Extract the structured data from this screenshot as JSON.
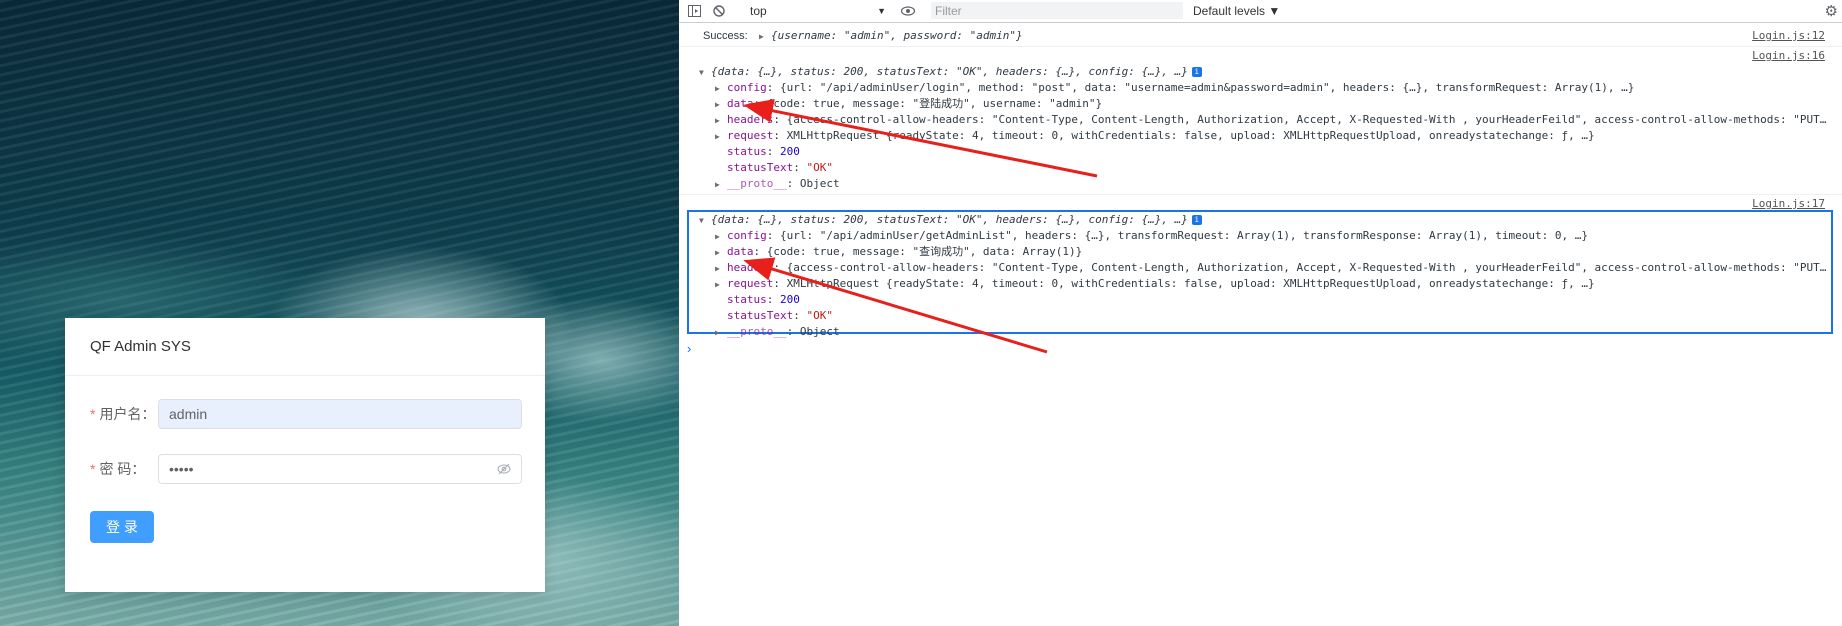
{
  "login": {
    "title": "QF Admin SYS",
    "username_label": "用户名",
    "username_value": "admin",
    "password_label": "密 码",
    "password_value": "•••••",
    "required_mark": "*",
    "submit_label": "登 录"
  },
  "devtools": {
    "context": "top",
    "filter_placeholder": "Filter",
    "levels": "Default levels ▼",
    "messages": [
      {
        "source": "Login.js:12",
        "label": "Success:",
        "text": "{username: \"admin\", password: \"admin\"}"
      },
      {
        "source": "Login.js:16",
        "summary": "{data: {…}, status: 200, statusText: \"OK\", headers: {…}, config: {…}, …}",
        "rows": [
          {
            "key": "config",
            "value": "{url: \"/api/adminUser/login\", method: \"post\", data: \"username=admin&password=admin\", headers: {…}, transformRequest: Array(1), …}"
          },
          {
            "key": "data",
            "value": "{code: true, message: \"登陆成功\", username: \"admin\"}"
          },
          {
            "key": "headers",
            "value": "{access-control-allow-headers: \"Content-Type, Content-Length, Authorization, Accept, X-Requested-With , yourHeaderFeild\", access-control-allow-methods: \"PUT…"
          },
          {
            "key": "request",
            "value": "XMLHttpRequest {readyState: 4, timeout: 0, withCredentials: false, upload: XMLHttpRequestUpload, onreadystatechange: ƒ, …}"
          },
          {
            "key": "status",
            "value": "200"
          },
          {
            "key": "statusText",
            "value": "\"OK\""
          },
          {
            "key": "__proto__",
            "value": "Object"
          }
        ]
      },
      {
        "source": "Login.js:17",
        "summary": "{data: {…}, status: 200, statusText: \"OK\", headers: {…}, config: {…}, …}",
        "rows": [
          {
            "key": "config",
            "value": "{url: \"/api/adminUser/getAdminList\", headers: {…}, transformRequest: Array(1), transformResponse: Array(1), timeout: 0, …}"
          },
          {
            "key": "data",
            "value": "{code: true, message: \"查询成功\", data: Array(1)}"
          },
          {
            "key": "headers",
            "value": "{access-control-allow-headers: \"Content-Type, Content-Length, Authorization, Accept, X-Requested-With , yourHeaderFeild\", access-control-allow-methods: \"PUT…"
          },
          {
            "key": "request",
            "value": "XMLHttpRequest {readyState: 4, timeout: 0, withCredentials: false, upload: XMLHttpRequestUpload, onreadystatechange: ƒ, …}"
          },
          {
            "key": "status",
            "value": "200"
          },
          {
            "key": "statusText",
            "value": "\"OK\""
          },
          {
            "key": "__proto__",
            "value": "Object"
          }
        ]
      }
    ],
    "prompt": "›"
  },
  "colors": {
    "primary_button": "#409eff",
    "annotation_arrow": "#e8201c",
    "selection_border": "#1a73e8"
  }
}
